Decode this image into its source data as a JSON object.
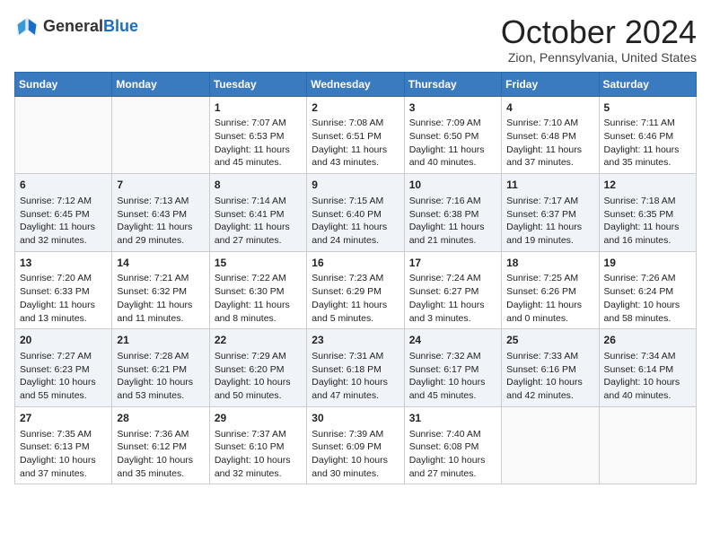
{
  "header": {
    "logo_general": "General",
    "logo_blue": "Blue",
    "month_title": "October 2024",
    "location": "Zion, Pennsylvania, United States"
  },
  "days_of_week": [
    "Sunday",
    "Monday",
    "Tuesday",
    "Wednesday",
    "Thursday",
    "Friday",
    "Saturday"
  ],
  "weeks": [
    [
      {
        "day": "",
        "sunrise": "",
        "sunset": "",
        "daylight": ""
      },
      {
        "day": "",
        "sunrise": "",
        "sunset": "",
        "daylight": ""
      },
      {
        "day": "1",
        "sunrise": "Sunrise: 7:07 AM",
        "sunset": "Sunset: 6:53 PM",
        "daylight": "Daylight: 11 hours and 45 minutes."
      },
      {
        "day": "2",
        "sunrise": "Sunrise: 7:08 AM",
        "sunset": "Sunset: 6:51 PM",
        "daylight": "Daylight: 11 hours and 43 minutes."
      },
      {
        "day": "3",
        "sunrise": "Sunrise: 7:09 AM",
        "sunset": "Sunset: 6:50 PM",
        "daylight": "Daylight: 11 hours and 40 minutes."
      },
      {
        "day": "4",
        "sunrise": "Sunrise: 7:10 AM",
        "sunset": "Sunset: 6:48 PM",
        "daylight": "Daylight: 11 hours and 37 minutes."
      },
      {
        "day": "5",
        "sunrise": "Sunrise: 7:11 AM",
        "sunset": "Sunset: 6:46 PM",
        "daylight": "Daylight: 11 hours and 35 minutes."
      }
    ],
    [
      {
        "day": "6",
        "sunrise": "Sunrise: 7:12 AM",
        "sunset": "Sunset: 6:45 PM",
        "daylight": "Daylight: 11 hours and 32 minutes."
      },
      {
        "day": "7",
        "sunrise": "Sunrise: 7:13 AM",
        "sunset": "Sunset: 6:43 PM",
        "daylight": "Daylight: 11 hours and 29 minutes."
      },
      {
        "day": "8",
        "sunrise": "Sunrise: 7:14 AM",
        "sunset": "Sunset: 6:41 PM",
        "daylight": "Daylight: 11 hours and 27 minutes."
      },
      {
        "day": "9",
        "sunrise": "Sunrise: 7:15 AM",
        "sunset": "Sunset: 6:40 PM",
        "daylight": "Daylight: 11 hours and 24 minutes."
      },
      {
        "day": "10",
        "sunrise": "Sunrise: 7:16 AM",
        "sunset": "Sunset: 6:38 PM",
        "daylight": "Daylight: 11 hours and 21 minutes."
      },
      {
        "day": "11",
        "sunrise": "Sunrise: 7:17 AM",
        "sunset": "Sunset: 6:37 PM",
        "daylight": "Daylight: 11 hours and 19 minutes."
      },
      {
        "day": "12",
        "sunrise": "Sunrise: 7:18 AM",
        "sunset": "Sunset: 6:35 PM",
        "daylight": "Daylight: 11 hours and 16 minutes."
      }
    ],
    [
      {
        "day": "13",
        "sunrise": "Sunrise: 7:20 AM",
        "sunset": "Sunset: 6:33 PM",
        "daylight": "Daylight: 11 hours and 13 minutes."
      },
      {
        "day": "14",
        "sunrise": "Sunrise: 7:21 AM",
        "sunset": "Sunset: 6:32 PM",
        "daylight": "Daylight: 11 hours and 11 minutes."
      },
      {
        "day": "15",
        "sunrise": "Sunrise: 7:22 AM",
        "sunset": "Sunset: 6:30 PM",
        "daylight": "Daylight: 11 hours and 8 minutes."
      },
      {
        "day": "16",
        "sunrise": "Sunrise: 7:23 AM",
        "sunset": "Sunset: 6:29 PM",
        "daylight": "Daylight: 11 hours and 5 minutes."
      },
      {
        "day": "17",
        "sunrise": "Sunrise: 7:24 AM",
        "sunset": "Sunset: 6:27 PM",
        "daylight": "Daylight: 11 hours and 3 minutes."
      },
      {
        "day": "18",
        "sunrise": "Sunrise: 7:25 AM",
        "sunset": "Sunset: 6:26 PM",
        "daylight": "Daylight: 11 hours and 0 minutes."
      },
      {
        "day": "19",
        "sunrise": "Sunrise: 7:26 AM",
        "sunset": "Sunset: 6:24 PM",
        "daylight": "Daylight: 10 hours and 58 minutes."
      }
    ],
    [
      {
        "day": "20",
        "sunrise": "Sunrise: 7:27 AM",
        "sunset": "Sunset: 6:23 PM",
        "daylight": "Daylight: 10 hours and 55 minutes."
      },
      {
        "day": "21",
        "sunrise": "Sunrise: 7:28 AM",
        "sunset": "Sunset: 6:21 PM",
        "daylight": "Daylight: 10 hours and 53 minutes."
      },
      {
        "day": "22",
        "sunrise": "Sunrise: 7:29 AM",
        "sunset": "Sunset: 6:20 PM",
        "daylight": "Daylight: 10 hours and 50 minutes."
      },
      {
        "day": "23",
        "sunrise": "Sunrise: 7:31 AM",
        "sunset": "Sunset: 6:18 PM",
        "daylight": "Daylight: 10 hours and 47 minutes."
      },
      {
        "day": "24",
        "sunrise": "Sunrise: 7:32 AM",
        "sunset": "Sunset: 6:17 PM",
        "daylight": "Daylight: 10 hours and 45 minutes."
      },
      {
        "day": "25",
        "sunrise": "Sunrise: 7:33 AM",
        "sunset": "Sunset: 6:16 PM",
        "daylight": "Daylight: 10 hours and 42 minutes."
      },
      {
        "day": "26",
        "sunrise": "Sunrise: 7:34 AM",
        "sunset": "Sunset: 6:14 PM",
        "daylight": "Daylight: 10 hours and 40 minutes."
      }
    ],
    [
      {
        "day": "27",
        "sunrise": "Sunrise: 7:35 AM",
        "sunset": "Sunset: 6:13 PM",
        "daylight": "Daylight: 10 hours and 37 minutes."
      },
      {
        "day": "28",
        "sunrise": "Sunrise: 7:36 AM",
        "sunset": "Sunset: 6:12 PM",
        "daylight": "Daylight: 10 hours and 35 minutes."
      },
      {
        "day": "29",
        "sunrise": "Sunrise: 7:37 AM",
        "sunset": "Sunset: 6:10 PM",
        "daylight": "Daylight: 10 hours and 32 minutes."
      },
      {
        "day": "30",
        "sunrise": "Sunrise: 7:39 AM",
        "sunset": "Sunset: 6:09 PM",
        "daylight": "Daylight: 10 hours and 30 minutes."
      },
      {
        "day": "31",
        "sunrise": "Sunrise: 7:40 AM",
        "sunset": "Sunset: 6:08 PM",
        "daylight": "Daylight: 10 hours and 27 minutes."
      },
      {
        "day": "",
        "sunrise": "",
        "sunset": "",
        "daylight": ""
      },
      {
        "day": "",
        "sunrise": "",
        "sunset": "",
        "daylight": ""
      }
    ]
  ]
}
